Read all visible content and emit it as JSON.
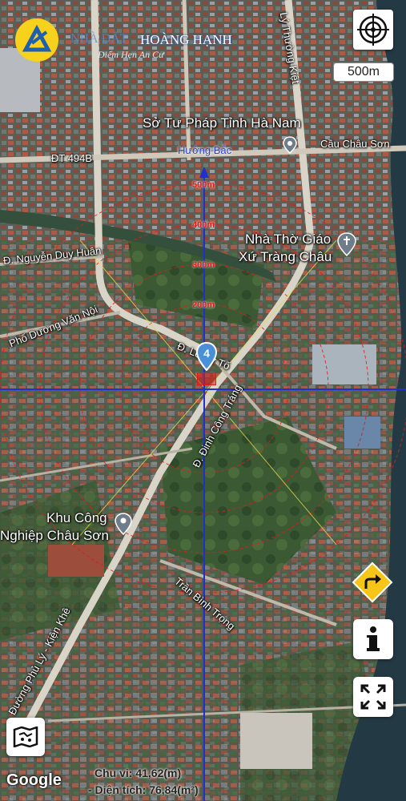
{
  "brand": {
    "ghost_text": "NHÀ ĐẤT",
    "name": "HOÀNG HẠNH",
    "tagline": "Điểm Hẹn An Cư"
  },
  "scale_label": "500m",
  "distance_rings": [
    "500m",
    "400m",
    "300m",
    "200m"
  ],
  "places": {
    "so_tu_phap": "Sở Tư Pháp Tỉnh Hà Nam",
    "nha_tho_line1": "Nhà Thờ Giáo",
    "nha_tho_line2": "Xứ Tràng Châu",
    "khu_cong_line1": "Khu Công",
    "khu_cong_line2": "Nghiệp Châu Sơn"
  },
  "streets": {
    "huong_bac": "Hướng Bắc",
    "dt494b": "ĐT 494B",
    "cau_chau_son": "Cầu Châu Sơn",
    "truong_kiet": "Lý Thường Kiệt",
    "nguyen_duy_huan": "Đ. Nguyễn Duy Huân",
    "duong_van_noi": "Phố Dương Văn Nội",
    "le_tu": "Đ. Lê Tử Tố",
    "dinh_cong_trang": "Đ. Đinh Công Tráng",
    "tran_binh_trong": "Trần Bình Trọng",
    "phu_ly_kien_khe": "Đường Phủ Lý - Kiện Khê"
  },
  "marker_number": "4",
  "stats": {
    "perimeter": "Chu vi: 41,62(m)",
    "area": "- Diện tích: 76,84(m²)"
  },
  "google_label": "Google",
  "icons": {
    "crosshair": "crosshair-icon",
    "directions": "directions-arrow-icon",
    "info": "info-icon",
    "fullscreen": "fullscreen-icon",
    "map_layers": "map-layers-icon"
  },
  "colors": {
    "crosshair": "#1f2fd0",
    "ring": "#e31a1a",
    "pin": "#4a90d9",
    "directions": "#f5c518"
  }
}
